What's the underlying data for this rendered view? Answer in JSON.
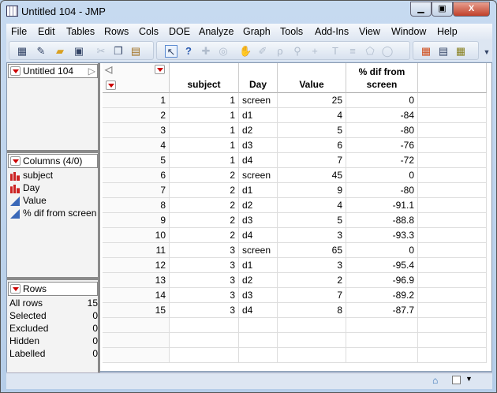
{
  "window": {
    "title": "Untitled 104 - JMP",
    "minimize": "▭",
    "maximize": "□",
    "close": "X"
  },
  "menu": [
    "File",
    "Edit",
    "Tables",
    "Rows",
    "Cols",
    "DOE",
    "Analyze",
    "Graph",
    "Tools",
    "Add-Ins",
    "View",
    "Window",
    "Help"
  ],
  "left": {
    "table_name": "Untitled 104",
    "columns_header": "Columns (4/0)",
    "columns": [
      {
        "name": "subject",
        "type": "nominal"
      },
      {
        "name": "Day",
        "type": "nominal"
      },
      {
        "name": "Value",
        "type": "continuous"
      },
      {
        "name": "% dif from screen",
        "type": "continuous"
      }
    ],
    "rows_header": "Rows",
    "row_stats": [
      {
        "label": "All rows",
        "value": "15"
      },
      {
        "label": "Selected",
        "value": "0"
      },
      {
        "label": "Excluded",
        "value": "0"
      },
      {
        "label": "Hidden",
        "value": "0"
      },
      {
        "label": "Labelled",
        "value": "0"
      }
    ]
  },
  "table": {
    "headers": [
      "subject",
      "Day",
      "Value",
      "% dif from\nscreen"
    ],
    "rows": [
      [
        "1",
        "1",
        "screen",
        "25",
        "0"
      ],
      [
        "2",
        "1",
        "d1",
        "4",
        "-84"
      ],
      [
        "3",
        "1",
        "d2",
        "5",
        "-80"
      ],
      [
        "4",
        "1",
        "d3",
        "6",
        "-76"
      ],
      [
        "5",
        "1",
        "d4",
        "7",
        "-72"
      ],
      [
        "6",
        "2",
        "screen",
        "45",
        "0"
      ],
      [
        "7",
        "2",
        "d1",
        "9",
        "-80"
      ],
      [
        "8",
        "2",
        "d2",
        "4",
        "-91.1"
      ],
      [
        "9",
        "2",
        "d3",
        "5",
        "-88.8"
      ],
      [
        "10",
        "2",
        "d4",
        "3",
        "-93.3"
      ],
      [
        "11",
        "3",
        "screen",
        "65",
        "0"
      ],
      [
        "12",
        "3",
        "d1",
        "3",
        "-95.4"
      ],
      [
        "13",
        "3",
        "d2",
        "2",
        "-96.9"
      ],
      [
        "14",
        "3",
        "d3",
        "7",
        "-89.2"
      ],
      [
        "15",
        "3",
        "d4",
        "8",
        "-87.7"
      ]
    ]
  }
}
